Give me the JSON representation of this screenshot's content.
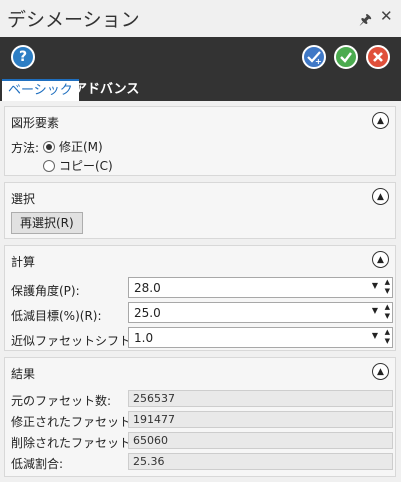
{
  "window": {
    "title": "デシメーション",
    "pin_icon": "pin-icon",
    "close_icon": "close-icon"
  },
  "toolbar": {
    "help_label": "?",
    "apply_icon": "apply-add-icon",
    "ok_icon": "check-icon",
    "cancel_icon": "cancel-icon",
    "colors": {
      "help": "#2d7ec4",
      "apply": "#3f78c6",
      "ok": "#4bab4f",
      "cancel": "#e0503b"
    }
  },
  "tabs": [
    {
      "label": "ベーシック",
      "active": true
    },
    {
      "label": "アドバンス",
      "active": false
    }
  ],
  "sections": {
    "shape": {
      "title": "図形要素",
      "method_label": "方法:",
      "options": [
        {
          "label": "修正(M)",
          "checked": true
        },
        {
          "label": "コピー(C)",
          "checked": false
        }
      ]
    },
    "selection": {
      "title": "選択",
      "reselect_label": "再選択(R)"
    },
    "calculation": {
      "title": "計算",
      "fields": [
        {
          "label": "保護角度(P):",
          "value": "28.0"
        },
        {
          "label": "低減目標(%)(R):",
          "value": "25.0"
        },
        {
          "label": "近似ファセットシフト:",
          "value": "1.0"
        }
      ]
    },
    "results": {
      "title": "結果",
      "fields": [
        {
          "label": "元のファセット数:",
          "value": "256537"
        },
        {
          "label": "修正されたファセット数:",
          "value": "191477"
        },
        {
          "label": "削除されたファセット:",
          "value": "65060"
        },
        {
          "label": "低減割合:",
          "value": "25.36"
        }
      ]
    }
  }
}
